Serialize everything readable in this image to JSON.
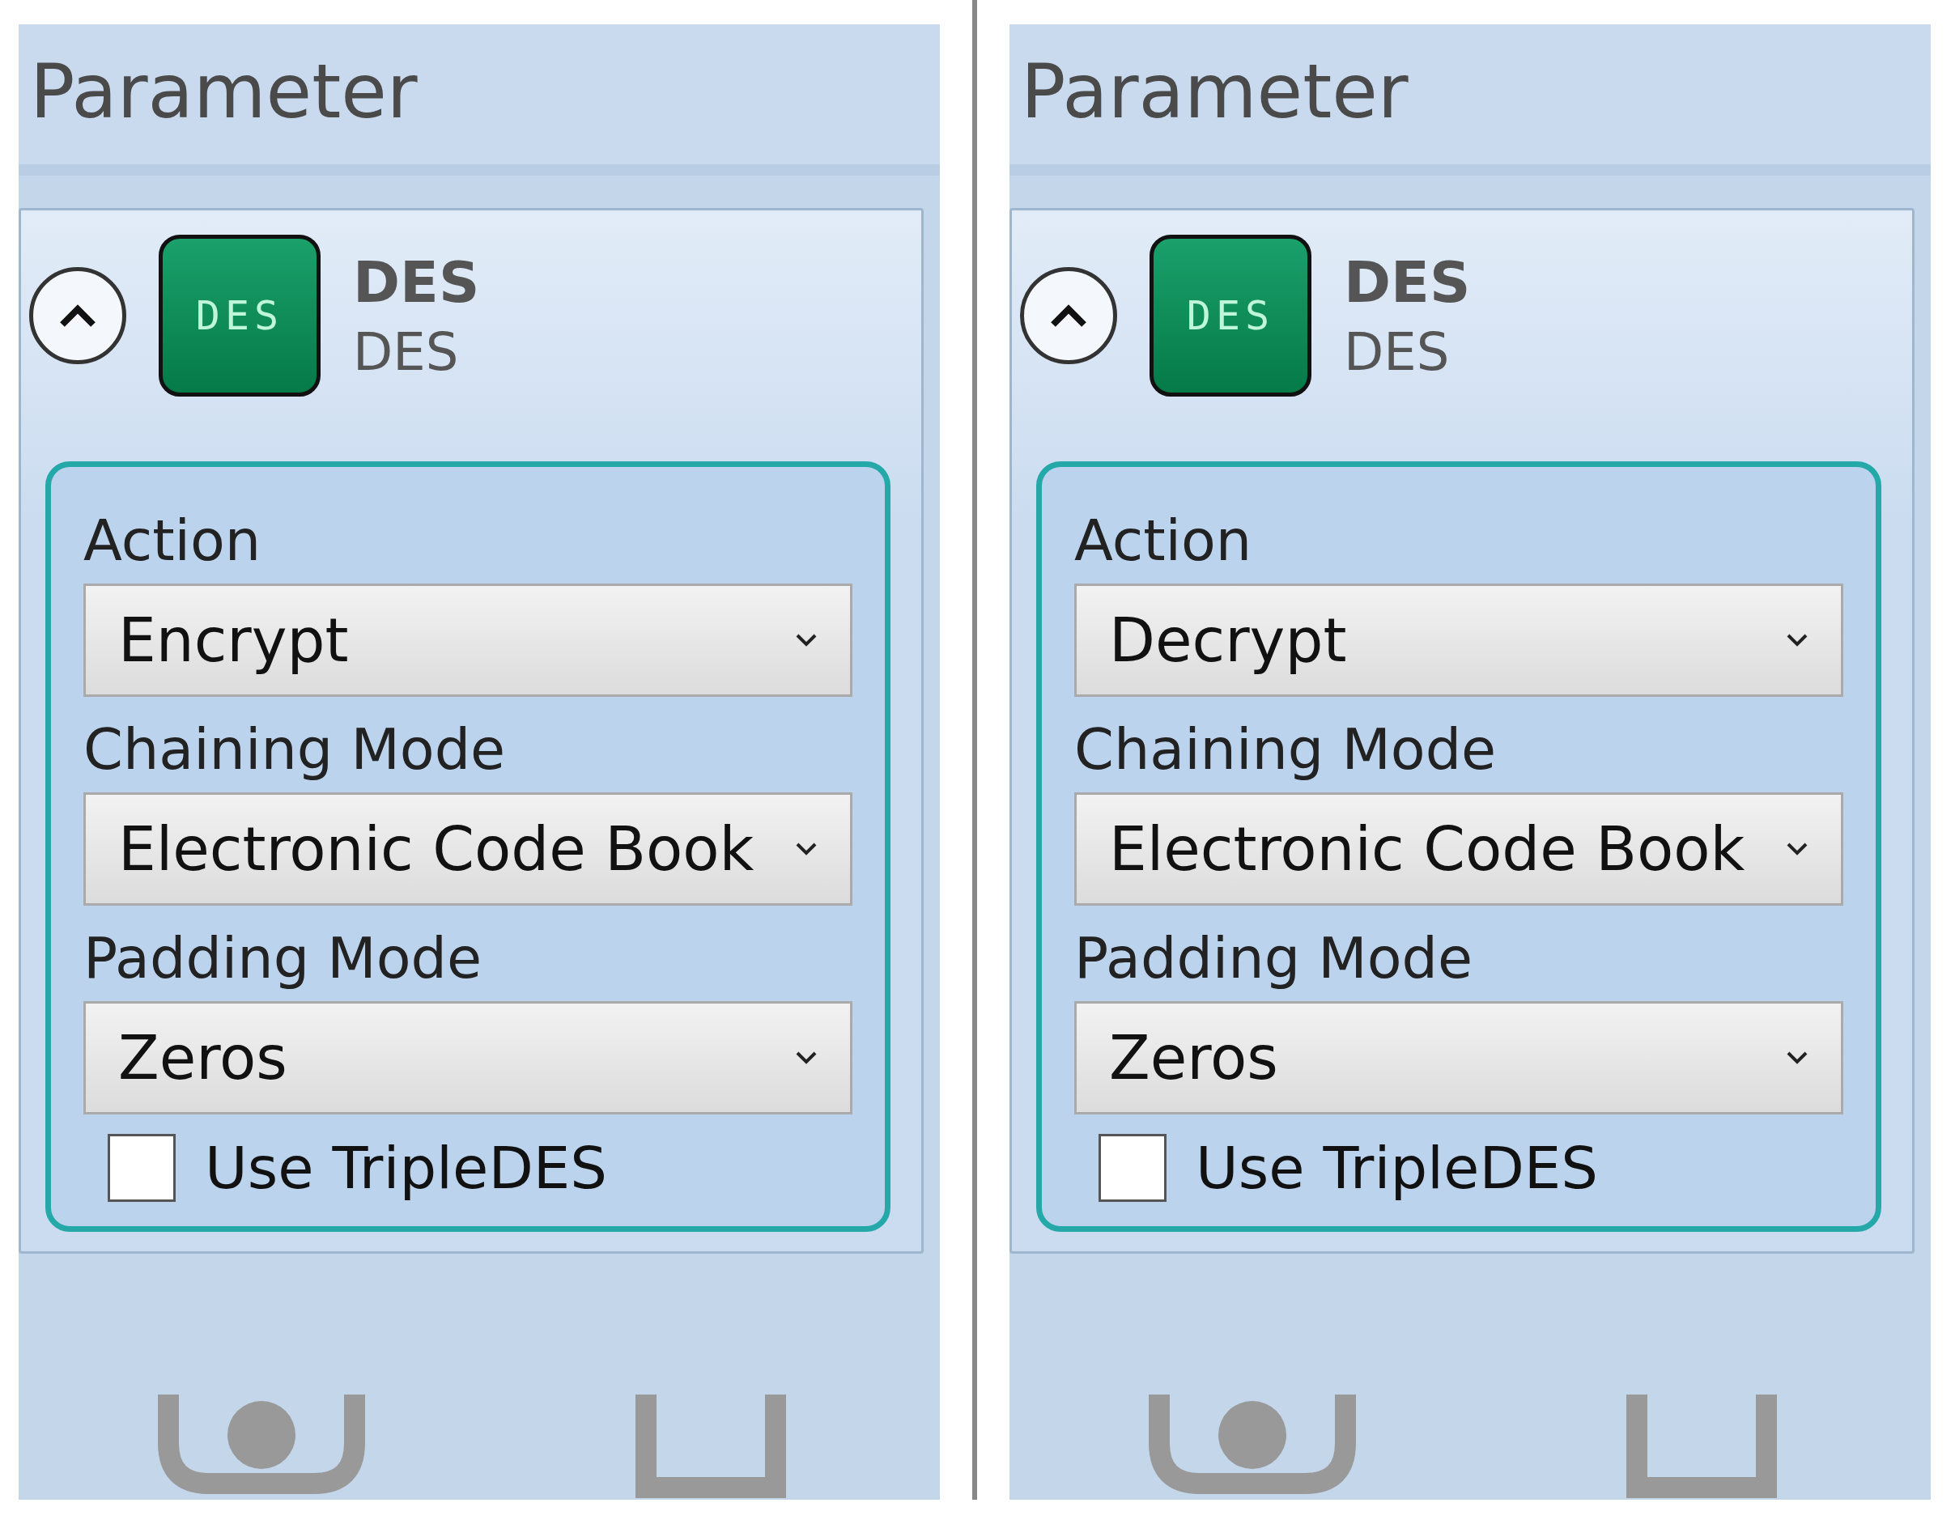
{
  "panels": [
    {
      "title": "Parameter",
      "plugin": {
        "icon_text": "DES",
        "name": "DES",
        "subtitle": "DES",
        "expanded": true
      },
      "fields": [
        {
          "label": "Action",
          "value": "Encrypt"
        },
        {
          "label": "Chaining Mode",
          "value": "Electronic Code Book"
        },
        {
          "label": "Padding Mode",
          "value": "Zeros"
        }
      ],
      "checkbox": {
        "label": "Use TripleDES",
        "checked": false
      }
    },
    {
      "title": "Parameter",
      "plugin": {
        "icon_text": "DES",
        "name": "DES",
        "subtitle": "DES",
        "expanded": true
      },
      "fields": [
        {
          "label": "Action",
          "value": "Decrypt"
        },
        {
          "label": "Chaining Mode",
          "value": "Electronic Code Book"
        },
        {
          "label": "Padding Mode",
          "value": "Zeros"
        }
      ],
      "checkbox": {
        "label": "Use TripleDES",
        "checked": false
      }
    }
  ]
}
